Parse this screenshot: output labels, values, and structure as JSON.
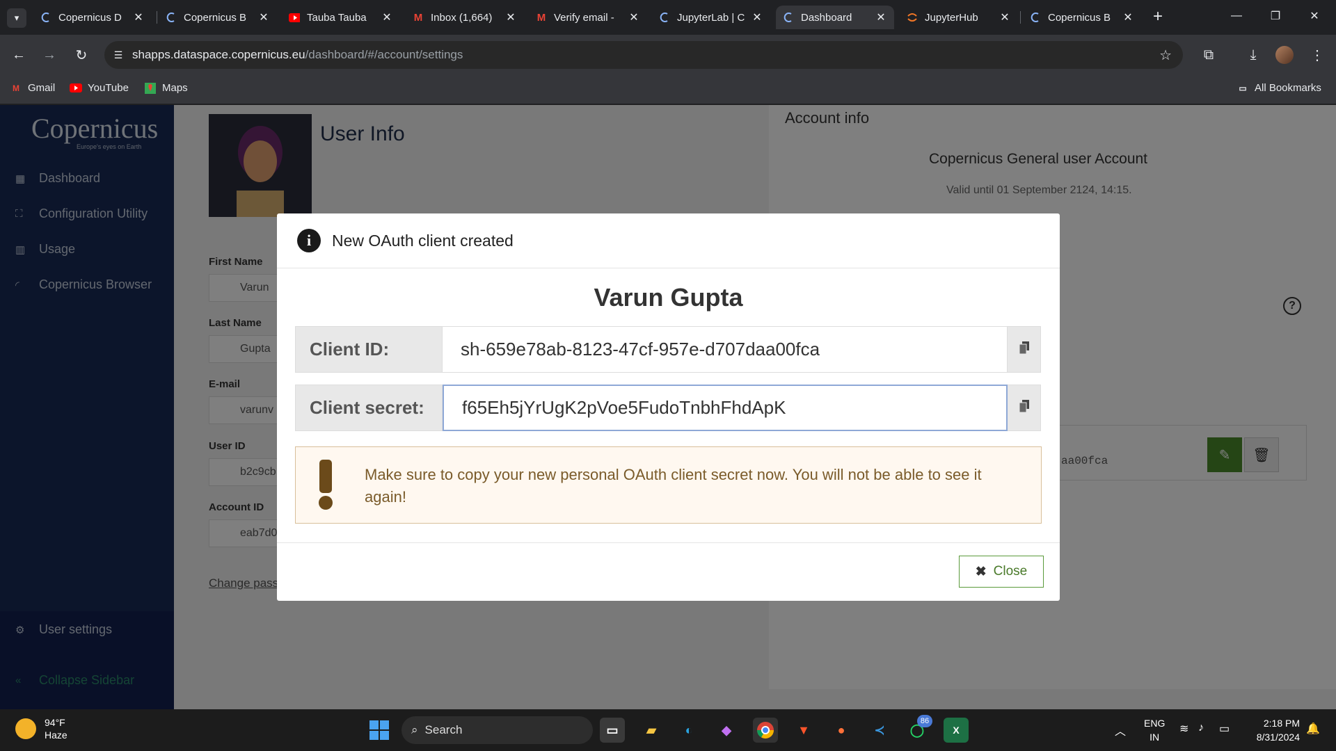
{
  "browser": {
    "tabs": [
      {
        "title": "Copernicus D",
        "icon": "copernicus-icon",
        "active": false
      },
      {
        "title": "Copernicus B",
        "icon": "copernicus-icon",
        "active": false
      },
      {
        "title": "Tauba Tauba",
        "icon": "youtube-icon",
        "active": false
      },
      {
        "title": "Inbox (1,664)",
        "icon": "gmail-icon",
        "active": false
      },
      {
        "title": "Verify email -",
        "icon": "gmail-icon",
        "active": false
      },
      {
        "title": "JupyterLab | C",
        "icon": "copernicus-icon",
        "active": false
      },
      {
        "title": "Dashboard",
        "icon": "copernicus-icon",
        "active": true
      },
      {
        "title": "JupyterHub",
        "icon": "jupyter-icon",
        "active": false
      },
      {
        "title": "Copernicus B",
        "icon": "copernicus-icon",
        "active": false
      }
    ],
    "url_host": "shapps.dataspace.copernicus.eu",
    "url_path": "/dashboard/#/account/settings",
    "bookmarks": [
      "Gmail",
      "YouTube",
      "Maps"
    ],
    "all_bookmarks": "All Bookmarks"
  },
  "sidebar": {
    "logo": "Copernicus",
    "logo_sub": "Europe's eyes on Earth",
    "items": [
      "Dashboard",
      "Configuration Utility",
      "Usage",
      "Copernicus Browser"
    ],
    "user_settings": "User settings",
    "collapse": "Collapse Sidebar"
  },
  "user_info": {
    "title": "User Info",
    "first_name_label": "First Name",
    "first_name": "Varun",
    "last_name_label": "Last Name",
    "last_name": "Gupta",
    "email_label": "E-mail",
    "email": "varunv",
    "user_id_label": "User ID",
    "user_id": "b2c9cb",
    "account_id_label": "Account ID",
    "account_id": "eab7d0",
    "change_password": "Change pass"
  },
  "account_info": {
    "title": "Account info",
    "account_type": "Copernicus General user Account",
    "valid_until": "Valid until 01 September 2124, 14:15.",
    "client_id_fragment": "aa00fca"
  },
  "modal": {
    "title": "New OAuth client created",
    "user_name": "Varun Gupta",
    "client_id_label": "Client ID:",
    "client_id": "sh-659e78ab-8123-47cf-957e-d707daa00fca",
    "client_secret_label": "Client secret:",
    "client_secret": "f65Eh5jYrUgK2pVoe5FudoTnbhFhdApK",
    "warning": "Make sure to copy your new personal OAuth client secret now. You will not be able to see it again!",
    "close": "Close"
  },
  "taskbar": {
    "temperature": "94°F",
    "weather": "Haze",
    "search": "Search",
    "whatsapp_badge": "86",
    "lang_1": "ENG",
    "lang_2": "IN",
    "time": "2:18 PM",
    "date": "8/31/2024"
  }
}
